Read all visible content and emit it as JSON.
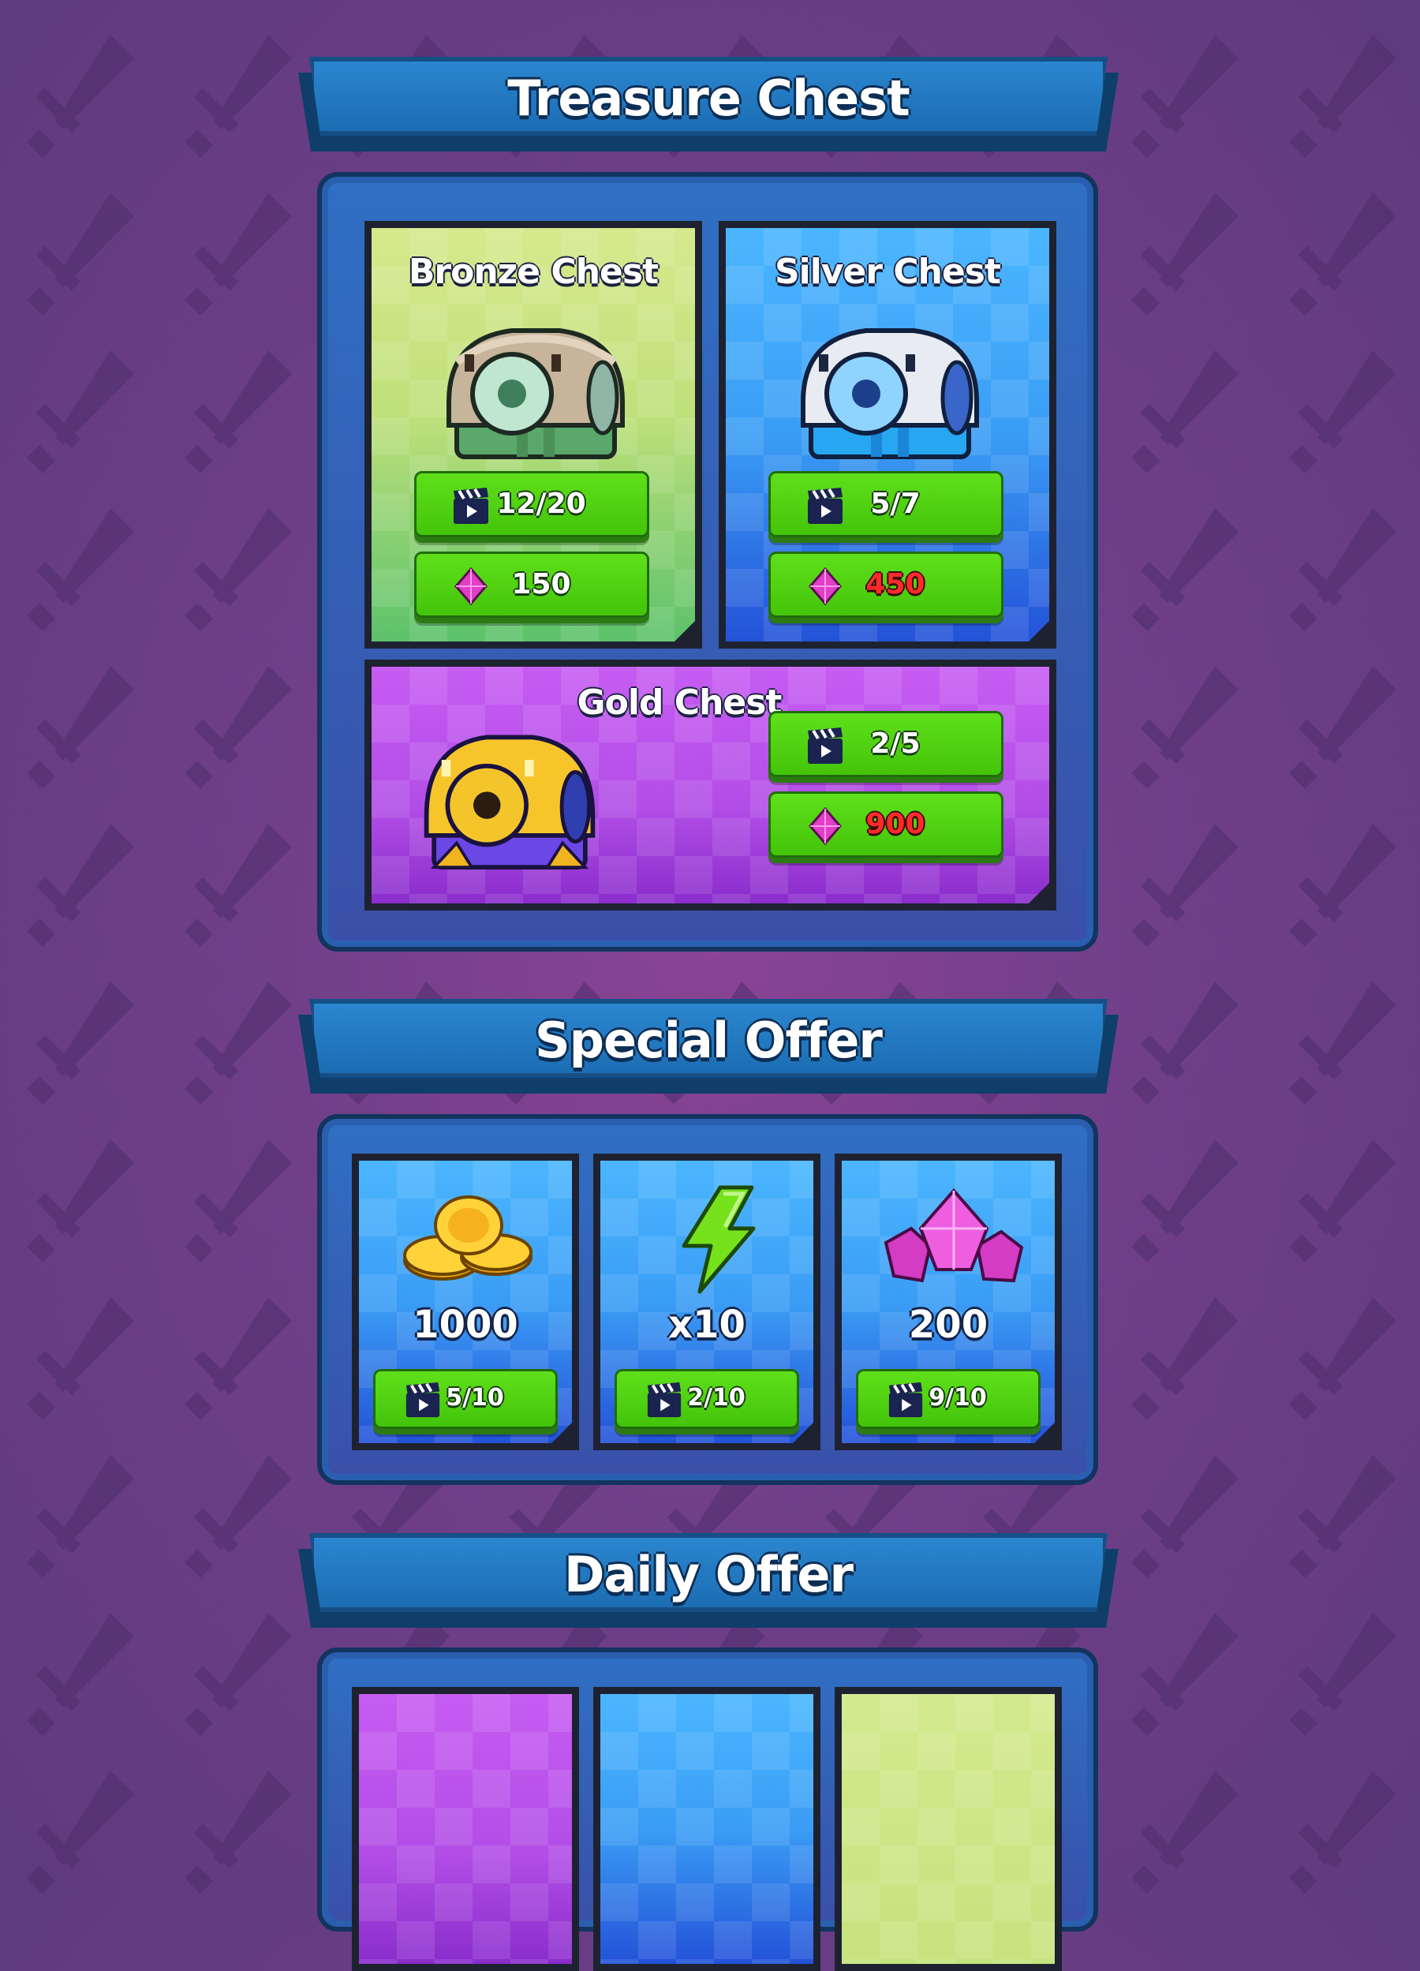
{
  "sections": {
    "treasure": {
      "title": "Treasure Chest",
      "chests": [
        {
          "name": "Bronze Chest",
          "ads": "12/20",
          "gems": "150",
          "gems_color": "#ffffff"
        },
        {
          "name": "Silver Chest",
          "ads": "5/7",
          "gems": "450",
          "gems_color": "#ff2a2a"
        },
        {
          "name": "Gold Chest",
          "ads": "2/5",
          "gems": "900",
          "gems_color": "#ff2a2a"
        }
      ]
    },
    "special": {
      "title": "Special Offer",
      "offers": [
        {
          "icon": "coins-icon",
          "amount": "1000",
          "ads": "5/10"
        },
        {
          "icon": "lightning-icon",
          "amount": "x10",
          "ads": "2/10"
        },
        {
          "icon": "gems-icon",
          "amount": "200",
          "ads": "9/10"
        }
      ]
    },
    "daily": {
      "title": "Daily Offer"
    }
  },
  "colors": {
    "button_green": "#4fd012",
    "price_red": "#ff2a2a",
    "banner_blue": "#2478c2",
    "background_purple": "#6f3f88"
  },
  "icons": {
    "ad_icon": "clapperboard-icon",
    "gem_icon": "pink-gem-icon",
    "background_icon": "sword-icon"
  }
}
